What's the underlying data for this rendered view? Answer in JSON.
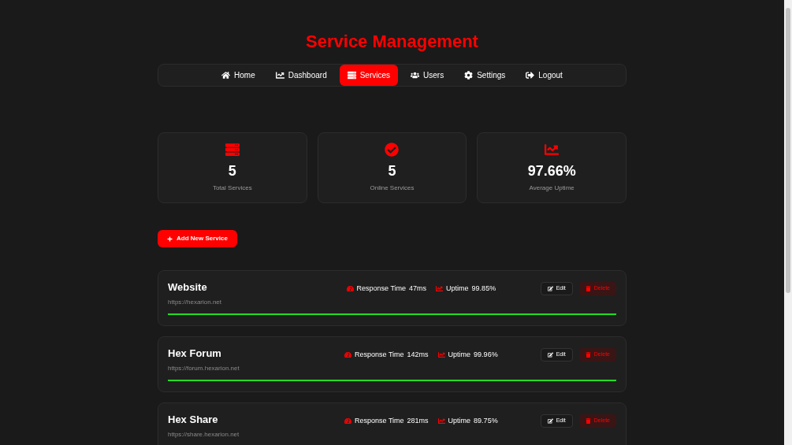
{
  "title": "Service Management",
  "nav": [
    {
      "label": "Home",
      "selected": false
    },
    {
      "label": "Dashboard",
      "selected": false
    },
    {
      "label": "Services",
      "selected": true
    },
    {
      "label": "Users",
      "selected": false
    },
    {
      "label": "Settings",
      "selected": false
    },
    {
      "label": "Logout",
      "selected": false
    }
  ],
  "stats": [
    {
      "value": "5",
      "label": "Total Services"
    },
    {
      "value": "5",
      "label": "Online Services"
    },
    {
      "value": "97.66%",
      "label": "Average Uptime"
    }
  ],
  "add_button": "Add New Service",
  "services": [
    {
      "name": "Website",
      "url": "https://hexarion.net",
      "response_label": "Response Time",
      "response": "47ms",
      "uptime_label": "Uptime",
      "uptime": "99.85%",
      "edit": "Edit",
      "delete": "Delete"
    },
    {
      "name": "Hex Forum",
      "url": "https://forum.hexarion.net",
      "response_label": "Response Time",
      "response": "142ms",
      "uptime_label": "Uptime",
      "uptime": "99.96%",
      "edit": "Edit",
      "delete": "Delete"
    },
    {
      "name": "Hex Share",
      "url": "https://share.hexarion.net",
      "response_label": "Response Time",
      "response": "281ms",
      "uptime_label": "Uptime",
      "uptime": "89.75%",
      "edit": "Edit",
      "delete": "Delete"
    }
  ]
}
